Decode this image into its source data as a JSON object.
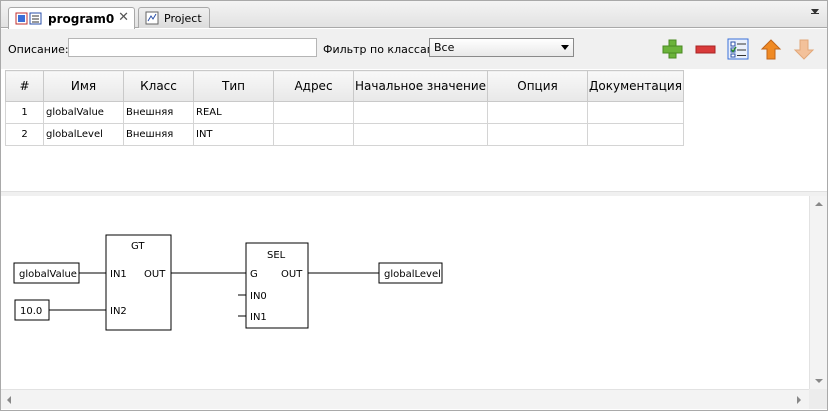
{
  "tabs": [
    {
      "label": "program0",
      "active": true
    },
    {
      "label": "Project",
      "active": false
    }
  ],
  "tab_close_glyph": "✕",
  "toolbar": {
    "description_label": "Описание:",
    "description_value": "",
    "filter_label": "Фильтр по классам:",
    "filter_value": "Все",
    "buttons": [
      "add-icon",
      "remove-icon",
      "checklist-icon",
      "move-up-icon",
      "move-down-icon"
    ]
  },
  "table": {
    "columns": [
      "#",
      "Имя",
      "Класс",
      "Тип",
      "Адрес",
      "Начальное значение",
      "Опция",
      "Документация"
    ],
    "rows": [
      {
        "num": "1",
        "name": "globalValue",
        "class": "Внешняя",
        "type": "REAL",
        "address": "",
        "initial": "",
        "option": "",
        "doc": ""
      },
      {
        "num": "2",
        "name": "globalLevel",
        "class": "Внешняя",
        "type": "INT",
        "address": "",
        "initial": "",
        "option": "",
        "doc": ""
      }
    ]
  },
  "diagram": {
    "gt_block": {
      "title": "GT",
      "in1": "IN1",
      "in2": "IN2",
      "out": "OUT"
    },
    "sel_block": {
      "title": "SEL",
      "g": "G",
      "in0": "IN0",
      "in1": "IN1",
      "out": "OUT"
    },
    "var_global_value": "globalValue",
    "const_value": "10.0",
    "var_global_level": "globalLevel"
  },
  "colors": {
    "add": "#6bb33a",
    "remove": "#d93a3a",
    "up": "#f08a24",
    "down_disabled": "#f3c19a"
  }
}
